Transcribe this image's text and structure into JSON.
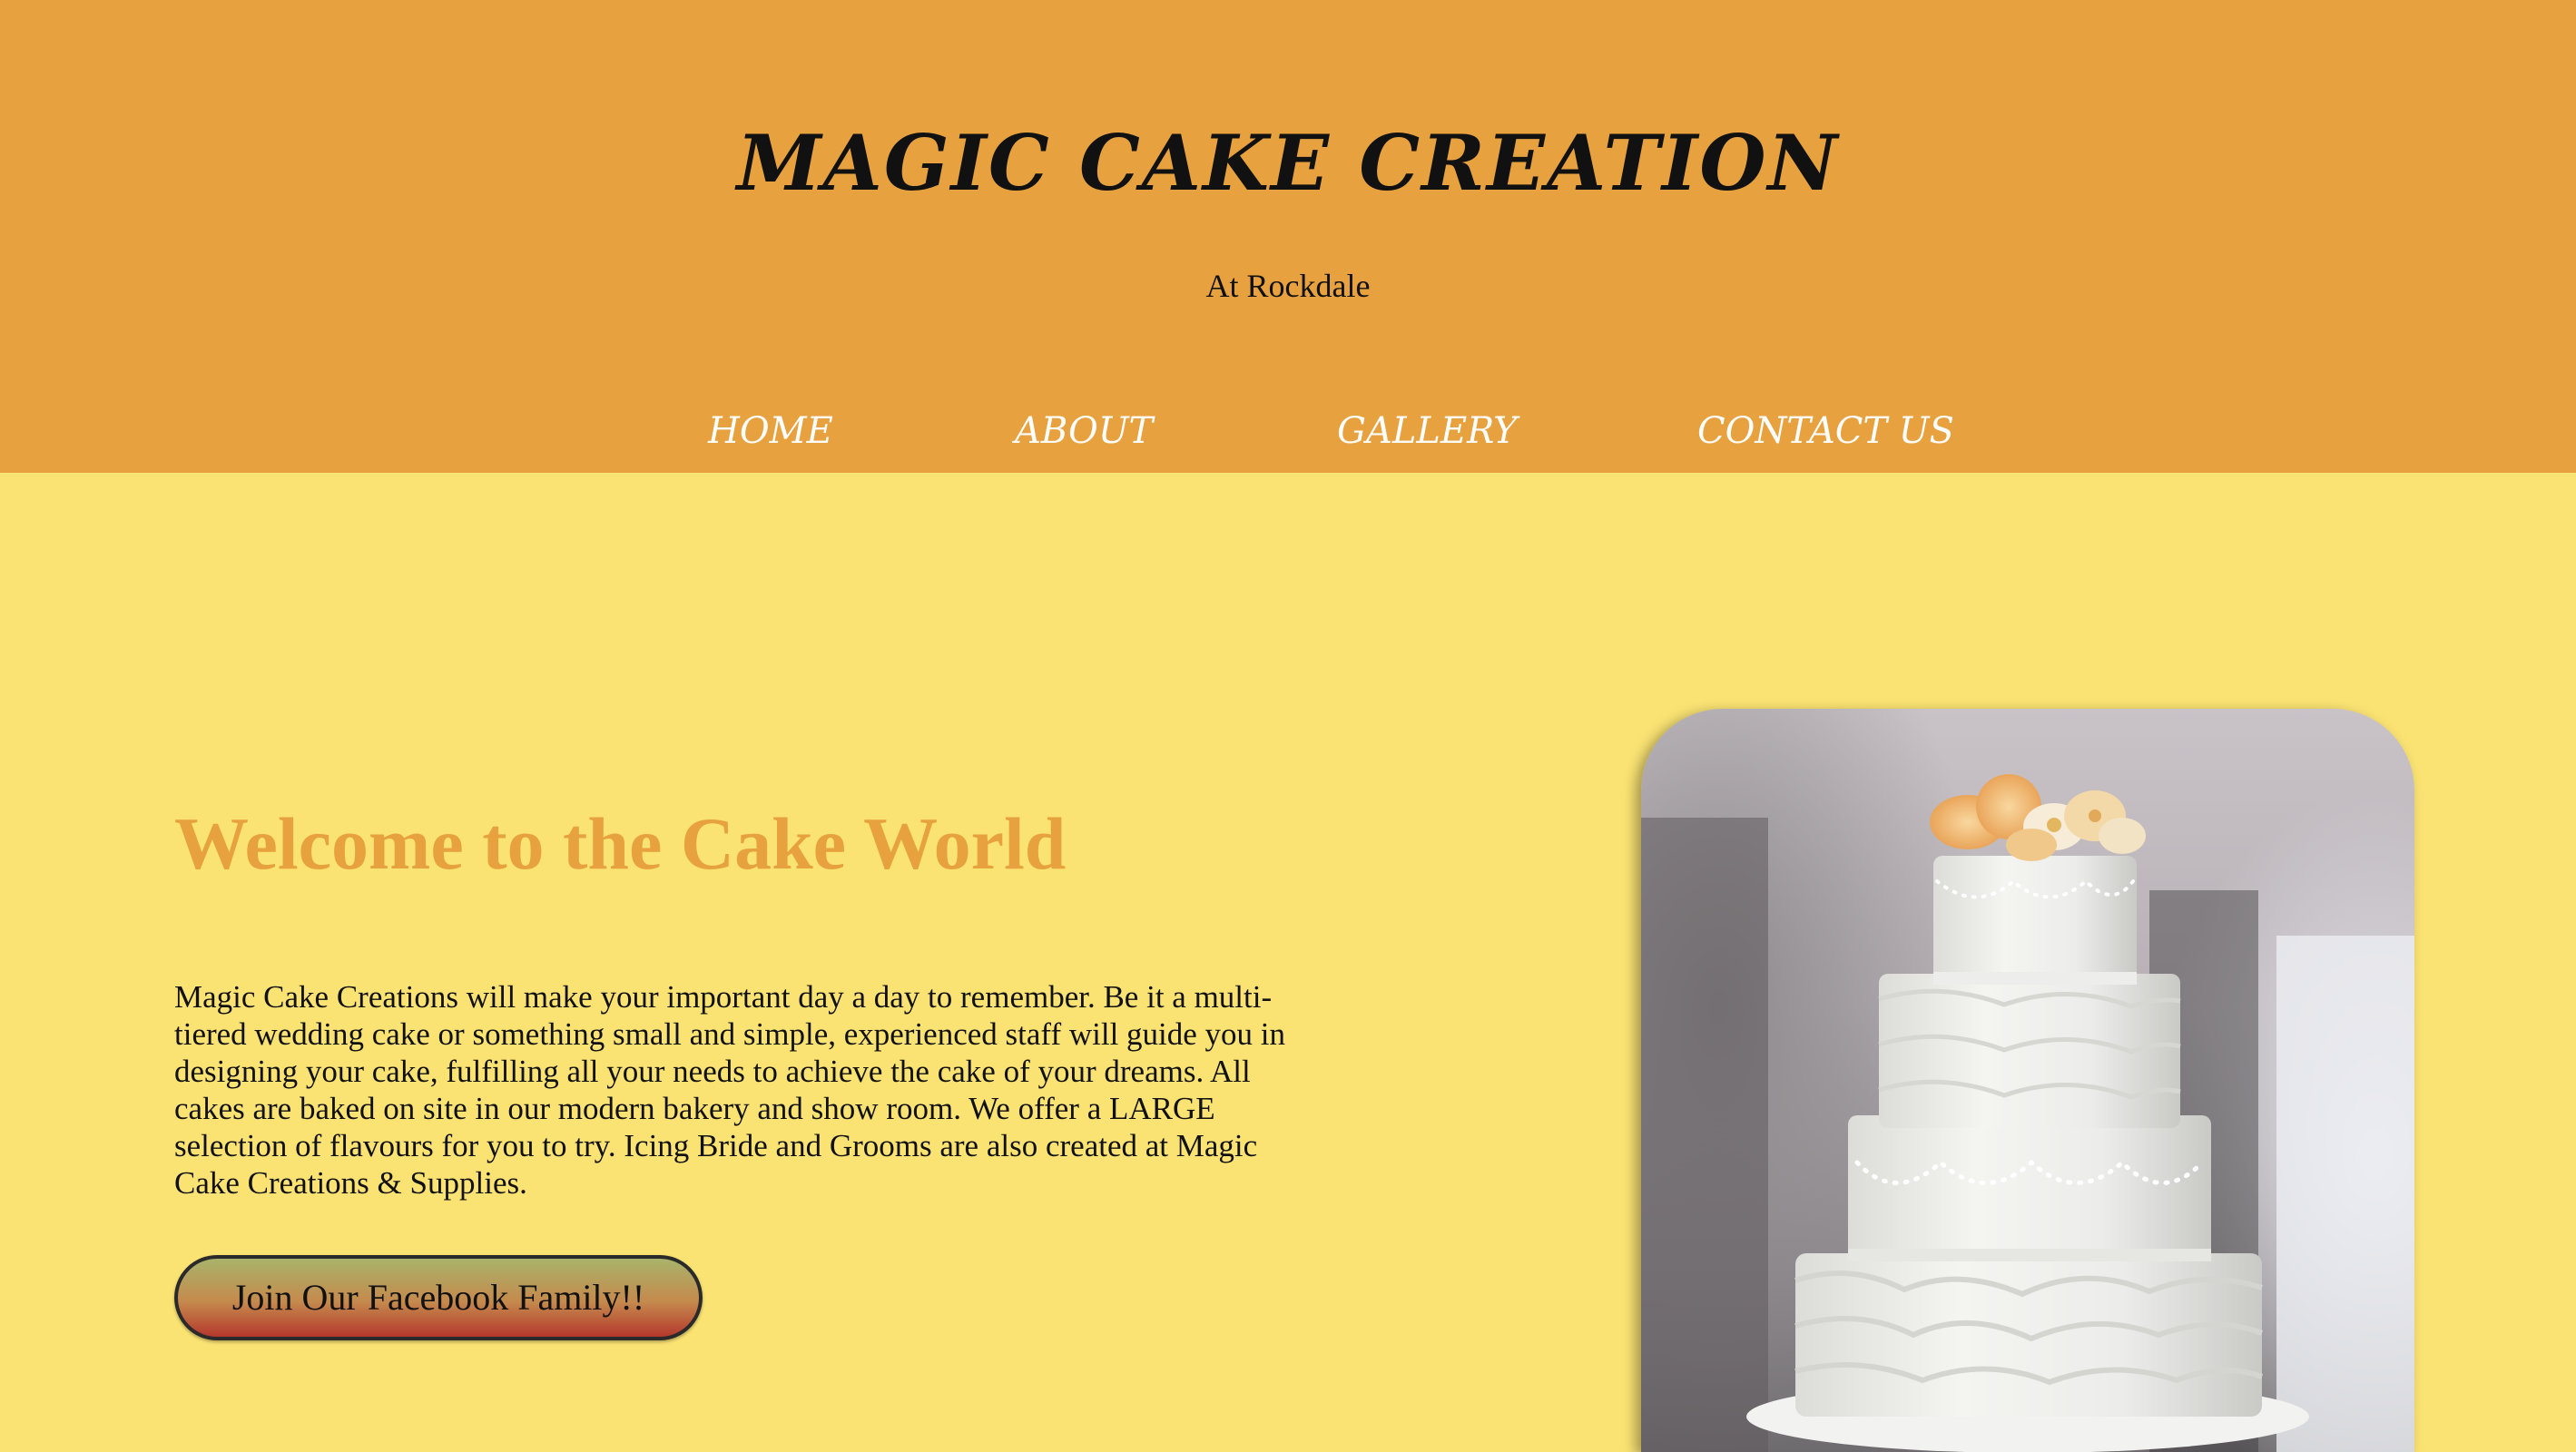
{
  "header": {
    "title": "MAGIC CAKE CREATION",
    "tagline": "At Rockdale"
  },
  "nav": {
    "items": [
      {
        "label": "HOME"
      },
      {
        "label": "ABOUT"
      },
      {
        "label": "GALLERY"
      },
      {
        "label": "CONTACT US"
      }
    ]
  },
  "main": {
    "heading": "Welcome to the Cake World",
    "intro": "Magic Cake Creations will make your important day a day to remember. Be it a multi-tiered wedding cake or something small and simple, experienced staff will guide you in designing your cake, fulfilling all your needs to achieve the cake of your dreams. All cakes are baked on site in our modern bakery and show room. We offer a LARGE selection of flavours for you to try. Icing Bride and Grooms are also created at Magic Cake Creations & Supplies.",
    "cta_label": "Join Our Facebook Family!!"
  },
  "colors": {
    "header_bg": "#e7a23f",
    "page_bg": "#fae373",
    "accent": "#e7a23f",
    "nav_text": "#ffffff"
  },
  "image": {
    "subject": "wedding-cake-photo"
  }
}
